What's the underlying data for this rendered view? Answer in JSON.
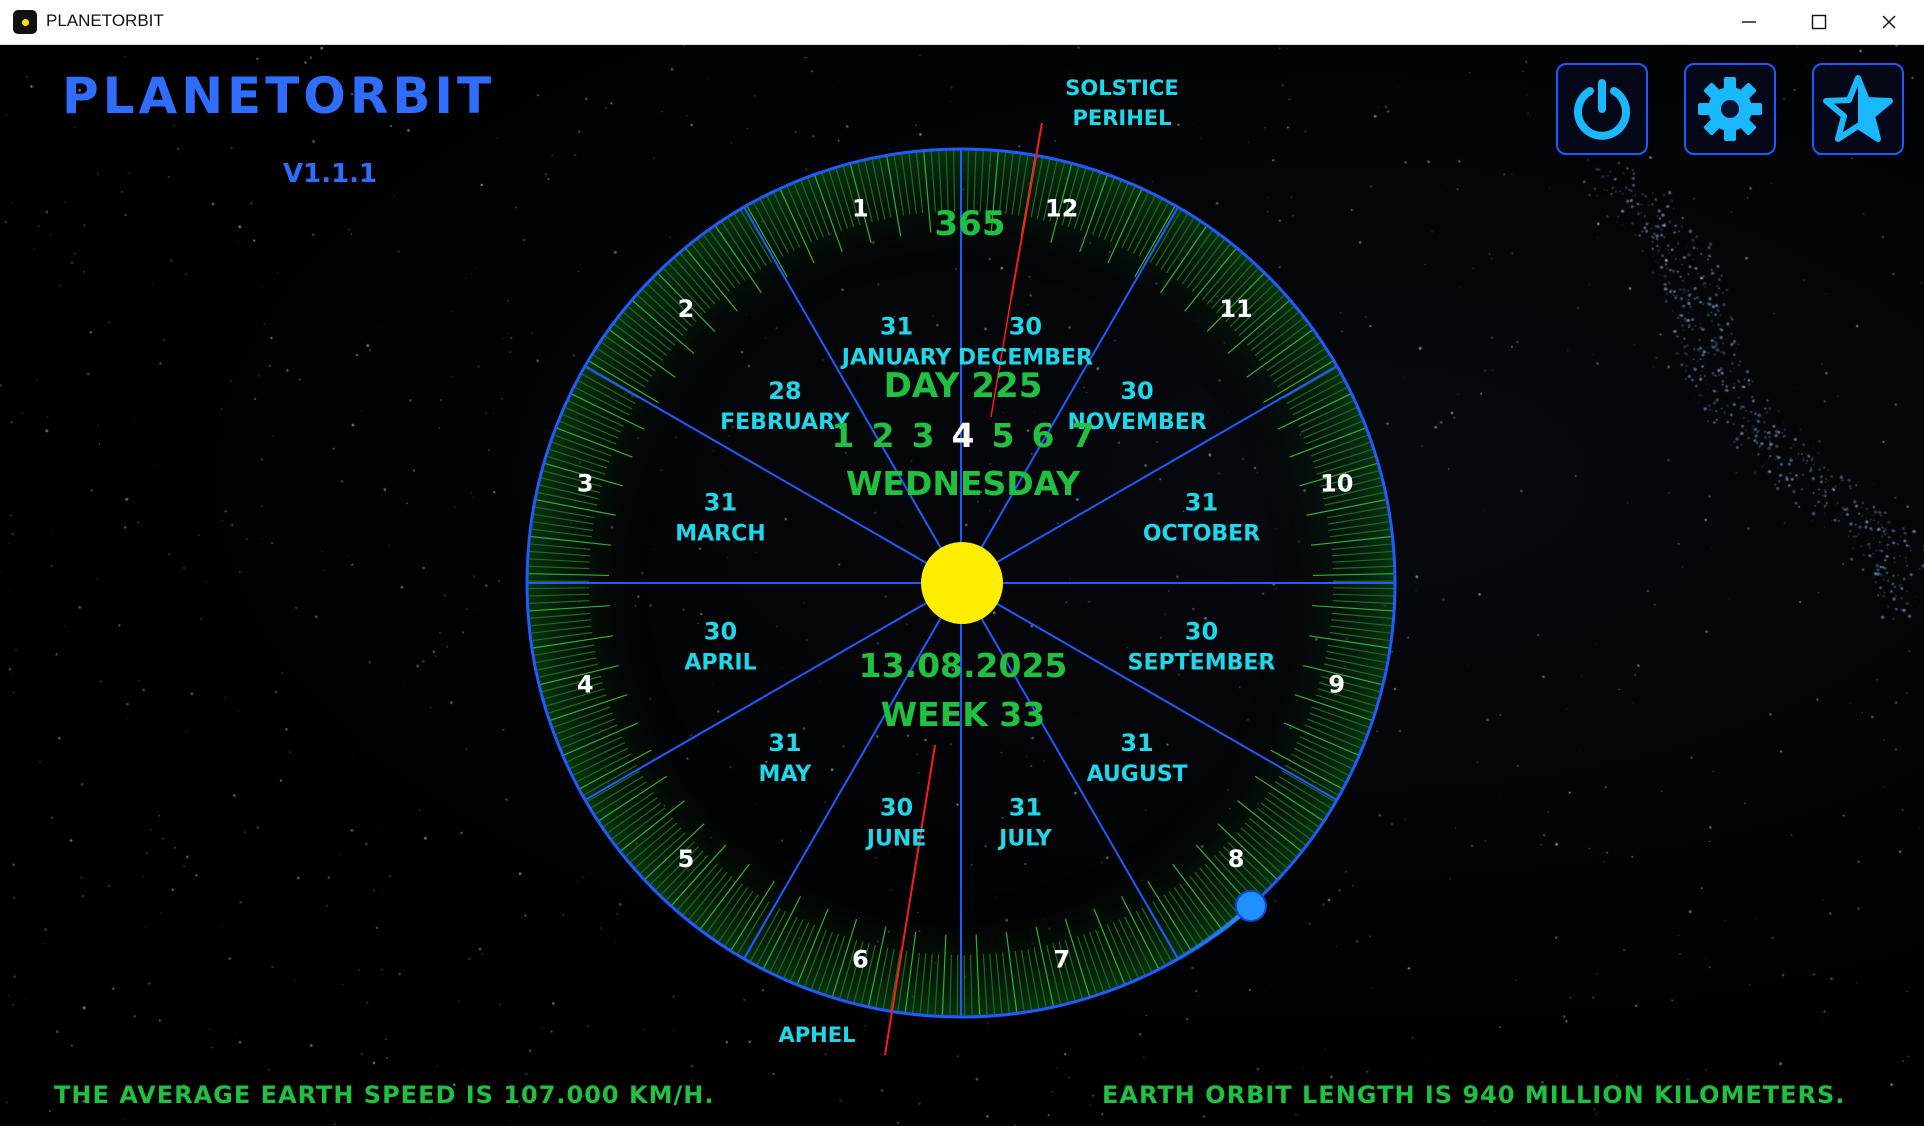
{
  "window": {
    "title": "PLANETORBIT",
    "controls": [
      "minimize",
      "maximize",
      "close"
    ]
  },
  "app": {
    "name": "PlanetOrbit",
    "version": "v1.1.1"
  },
  "toolbar": {
    "buttons": [
      {
        "name": "power-button",
        "icon": "power-icon"
      },
      {
        "name": "settings-button",
        "icon": "gear-icon"
      },
      {
        "name": "favorites-button",
        "icon": "star-icon"
      }
    ]
  },
  "dial": {
    "total_days": "365",
    "day_label": "Day 225",
    "weekdays": [
      "1",
      "2",
      "3",
      "4",
      "5",
      "6",
      "7"
    ],
    "current_weekday_index": 4,
    "weekday_name": "Wednesday",
    "date": "13.08.2025",
    "week": "Week 33",
    "solstice_label": "Solstice",
    "perihel_label": "Perihel",
    "aphel_label": "Aphel",
    "earth_day": 225,
    "months": [
      {
        "num": "1",
        "days": "31",
        "name": "January"
      },
      {
        "num": "2",
        "days": "28",
        "name": "February"
      },
      {
        "num": "3",
        "days": "31",
        "name": "March"
      },
      {
        "num": "4",
        "days": "30",
        "name": "April"
      },
      {
        "num": "5",
        "days": "31",
        "name": "May"
      },
      {
        "num": "6",
        "days": "30",
        "name": "June"
      },
      {
        "num": "7",
        "days": "31",
        "name": "July"
      },
      {
        "num": "8",
        "days": "31",
        "name": "August"
      },
      {
        "num": "9",
        "days": "30",
        "name": "September"
      },
      {
        "num": "10",
        "days": "31",
        "name": "October"
      },
      {
        "num": "11",
        "days": "30",
        "name": "November"
      },
      {
        "num": "12",
        "days": "30",
        "name": "December"
      }
    ]
  },
  "footer": {
    "speed_text": "The average earth speed is 107.000 km/h.",
    "orbit_text": "Earth orbit length is 940 million kilometers."
  },
  "colors": {
    "brand_blue": "#2f6dff",
    "cyan": "#1fd7e8",
    "green": "#20c040",
    "sun": "#ffee00",
    "earth": "#1e90ff",
    "marker_red": "#ff1a1a"
  }
}
